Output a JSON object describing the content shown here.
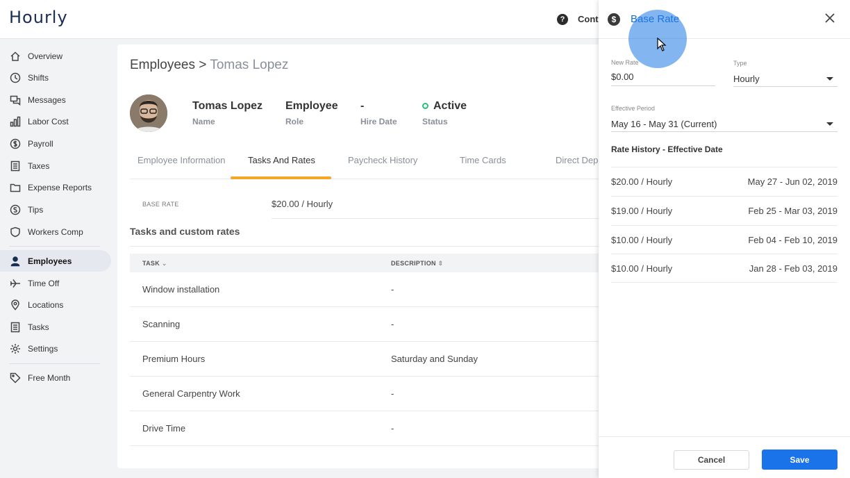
{
  "app": {
    "logo": "Hourly",
    "contact_label": "Conta"
  },
  "sidebar": {
    "items": [
      {
        "label": "Overview"
      },
      {
        "label": "Shifts"
      },
      {
        "label": "Messages"
      },
      {
        "label": "Labor Cost"
      },
      {
        "label": "Payroll"
      },
      {
        "label": "Taxes"
      },
      {
        "label": "Expense Reports"
      },
      {
        "label": "Tips"
      },
      {
        "label": "Workers Comp"
      },
      {
        "label": "Employees"
      },
      {
        "label": "Time Off"
      },
      {
        "label": "Locations"
      },
      {
        "label": "Tasks"
      },
      {
        "label": "Settings"
      },
      {
        "label": "Free Month"
      }
    ]
  },
  "breadcrumb": {
    "section": "Employees",
    "separator": ">",
    "current": "Tomas Lopez"
  },
  "employee": {
    "name": "Tomas Lopez",
    "name_label": "Name",
    "role": "Employee",
    "role_label": "Role",
    "hire_date": "-",
    "hire_date_label": "Hire Date",
    "status": "Active",
    "status_label": "Status"
  },
  "tabs": [
    {
      "label": "Employee Information"
    },
    {
      "label": "Tasks And Rates"
    },
    {
      "label": "Paycheck History"
    },
    {
      "label": "Time Cards"
    },
    {
      "label": "Direct Depo"
    }
  ],
  "base_rate": {
    "label": "BASE RATE",
    "value": "$20.00 / Hourly"
  },
  "tasks": {
    "title": "Tasks and custom rates",
    "headers": {
      "task": "TASK",
      "description": "DESCRIPTION"
    },
    "rows": [
      {
        "task": "Window installation",
        "description": "-"
      },
      {
        "task": "Scanning",
        "description": "-"
      },
      {
        "task": "Premium Hours",
        "description": "Saturday and Sunday"
      },
      {
        "task": "General Carpentry Work",
        "description": "-"
      },
      {
        "task": "Drive Time",
        "description": "-"
      }
    ]
  },
  "panel": {
    "title": "Base Rate",
    "new_rate_label": "New Rate",
    "new_rate_value": "$0.00",
    "type_label": "Type",
    "type_value": "Hourly",
    "period_label": "Effective Period",
    "period_value": "May 16 - May 31 (Current)",
    "history_title": "Rate History - Effective Date",
    "history": [
      {
        "rate": "$20.00 / Hourly",
        "date": "May 27 - Jun 02, 2019"
      },
      {
        "rate": "$19.00 / Hourly",
        "date": "Feb 25 - Mar 03, 2019"
      },
      {
        "rate": "$10.00 / Hourly",
        "date": "Feb 04 - Feb 10, 2019"
      },
      {
        "rate": "$10.00 / Hourly",
        "date": "Jan 28 - Feb 03, 2019"
      }
    ],
    "cancel_label": "Cancel",
    "save_label": "Save"
  },
  "colors": {
    "accent": "#1a73e8",
    "tab_underline": "#f5a623",
    "status_active": "#27c27a",
    "logo": "#1a2d52"
  }
}
